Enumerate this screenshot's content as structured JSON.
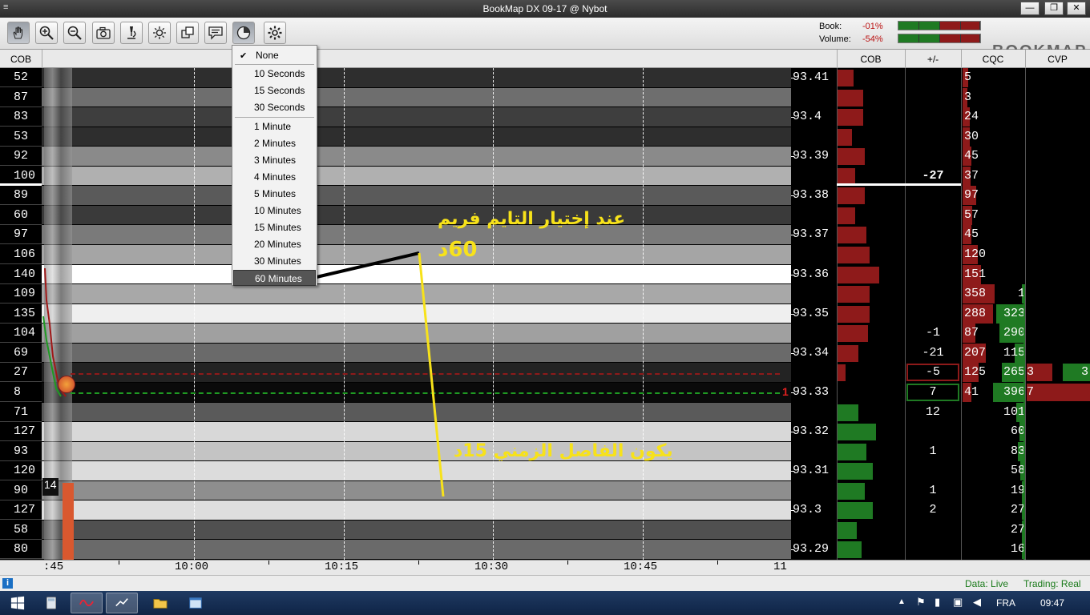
{
  "window": {
    "title": "BookMap   DX 09-17 @ Nybot",
    "menu_icon": "≡",
    "minimize_label": "—",
    "maximize_label": "❐",
    "close_label": "✕"
  },
  "toolbar": {
    "buttons": [
      "hand-icon",
      "zoom-in-icon",
      "zoom-out-icon",
      "camera-icon",
      "microscope-icon",
      "brightness-icon",
      "layers-icon",
      "chat-icon",
      "clock-icon",
      "gear-icon"
    ]
  },
  "summary": {
    "book_label": "Book:",
    "book_value": "-01%",
    "volume_label": "Volume:",
    "volume_value": "-54%",
    "brand": "BOOKMAP"
  },
  "dropdown": {
    "items": [
      "None",
      "10 Seconds",
      "15 Seconds",
      "30 Seconds",
      "1 Minute",
      "2 Minutes",
      "3 Minutes",
      "4 Minutes",
      "5 Minutes",
      "10 Minutes",
      "15 Minutes",
      "20 Minutes",
      "30 Minutes",
      "60 Minutes"
    ],
    "checked": "None",
    "selected": "60 Minutes",
    "check_mark": "✔"
  },
  "headers": {
    "left_cob": "COB",
    "right_cob": "COB",
    "plus_minus": "+/-",
    "cqc": "CQC",
    "cvp": "CVP"
  },
  "rows": {
    "cob_left": [
      "52",
      "87",
      "83",
      "53",
      "92",
      "100",
      "89",
      "60",
      "97",
      "106",
      "140",
      "109",
      "135",
      "104",
      "69",
      "27",
      "8",
      "71",
      "127",
      "93",
      "120",
      "90",
      "127",
      "58",
      "80"
    ],
    "band_colors": [
      "#2e2e2e",
      "#6e6e6e",
      "#3e3e3e",
      "#2e2e2e",
      "#8a8a8a",
      "#b0b0b0",
      "#5a5a5a",
      "#3a3a3a",
      "#7a7a7a",
      "#a5a5a5",
      "#ffffff",
      "#a8a8a8",
      "#efefef",
      "#a0a0a0",
      "#6a6a6a",
      "#232323",
      "#0a0a0a",
      "#5a5a5a",
      "#d8d8d8",
      "#c4c4c4",
      "#dcdcdc",
      "#8e8e8e",
      "#dedede",
      "#505050",
      "#6a6a6a"
    ],
    "plus_minus": [
      "",
      "",
      "",
      "",
      "",
      "-27",
      "",
      "",
      "",
      "",
      "",
      "",
      "",
      "-1",
      "-21",
      "-5",
      "7",
      "12",
      "",
      "1",
      "",
      "1",
      "2",
      "",
      ""
    ],
    "cqc_bid": [
      "5",
      "3",
      "24",
      "30",
      "45",
      "37",
      "97",
      "57",
      "45",
      "120",
      "151",
      "358",
      "288",
      "87",
      "207",
      "125",
      "41",
      "",
      "",
      "",
      "",
      "",
      "",
      "",
      ""
    ],
    "cqc_ask": [
      "",
      "",
      "",
      "",
      "",
      "",
      "",
      "",
      "",
      "",
      "",
      "1",
      "323",
      "290",
      "115",
      "265",
      "396",
      "101",
      "60",
      "83",
      "58",
      "19",
      "27",
      "27",
      "16"
    ],
    "cvp": [
      "",
      "",
      "",
      "",
      "",
      "",
      "",
      "",
      "",
      "",
      "",
      "",
      "",
      "",
      "",
      "3",
      "7",
      "",
      "",
      "",
      "",
      "",
      "",
      "",
      ""
    ],
    "cvp_right": [
      "",
      "",
      "",
      "",
      "",
      "",
      "",
      "",
      "",
      "",
      "",
      "",
      "",
      "",
      "",
      "3",
      "",
      "",
      "",
      "",
      "",
      "",
      "",
      "",
      ""
    ],
    "marker_last": "1",
    "volume_box": "14"
  },
  "prices": [
    "93.41",
    "93.4",
    "93.39",
    "93.38",
    "93.37",
    "93.36",
    "93.35",
    "93.34",
    "93.33",
    "93.32",
    "93.31",
    "93.3",
    "93.29"
  ],
  "time_axis": [
    ":45",
    "10:00",
    "10:15",
    "10:30",
    "10:45",
    "11"
  ],
  "annotations": {
    "top_line1": "عند إختيار التايم فريم",
    "top_line2": "60د",
    "bottom": "يكون الفاصل الزمني 15د"
  },
  "status": {
    "data": "Data: Live",
    "trading": "Trading: Real"
  },
  "taskbar": {
    "lang": "FRA",
    "time": "09:47"
  },
  "colors": {
    "ask_red": "#8e1a1a",
    "bid_green": "#1f7a23",
    "annotation": "#f7e21a"
  }
}
